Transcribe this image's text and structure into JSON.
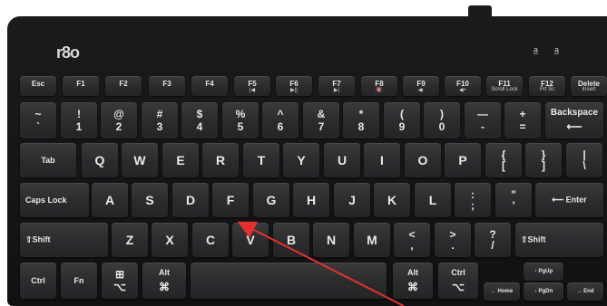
{
  "brand": {
    "logo_text": "r8o"
  },
  "indicators": [
    {
      "icon": "caps-lock-led-icon",
      "glyph": "a̲"
    },
    {
      "icon": "num-lock-led-icon",
      "glyph": "a̲"
    }
  ],
  "function_row": [
    {
      "main": "Esc",
      "sub": ""
    },
    {
      "main": "F1",
      "sub": ""
    },
    {
      "main": "F2",
      "sub": ""
    },
    {
      "main": "F3",
      "sub": ""
    },
    {
      "main": "F4",
      "sub": ""
    },
    {
      "main": "F5",
      "sub": "|◀"
    },
    {
      "main": "F6",
      "sub": "▶||"
    },
    {
      "main": "F7",
      "sub": "▶|"
    },
    {
      "main": "F8",
      "sub": "🔇"
    },
    {
      "main": "F9",
      "sub": "◀-"
    },
    {
      "main": "F10",
      "sub": "◀+"
    },
    {
      "main": "F11",
      "sub": "Scroll Lock"
    },
    {
      "main": "F12",
      "sub": "Prt Sc"
    },
    {
      "main": "Delete",
      "sub": "Insert"
    }
  ],
  "number_row": [
    {
      "top": "~",
      "bot": "`"
    },
    {
      "top": "!",
      "bot": "1"
    },
    {
      "top": "@",
      "bot": "2"
    },
    {
      "top": "#",
      "bot": "3"
    },
    {
      "top": "$",
      "bot": "4"
    },
    {
      "top": "%",
      "bot": "5"
    },
    {
      "top": "^",
      "bot": "6"
    },
    {
      "top": "&",
      "bot": "7"
    },
    {
      "top": "*",
      "bot": "8"
    },
    {
      "top": "(",
      "bot": "9"
    },
    {
      "top": ")",
      "bot": "0"
    },
    {
      "top": "—",
      "bot": "-"
    },
    {
      "top": "+",
      "bot": "="
    },
    {
      "top": "Backspace",
      "bot": "⟵"
    }
  ],
  "qwerty_row": {
    "tab": "Tab",
    "letters": [
      "Q",
      "W",
      "E",
      "R",
      "T",
      "Y",
      "U",
      "I",
      "O",
      "P"
    ],
    "brackets": [
      {
        "top": "{",
        "bot": "["
      },
      {
        "top": "}",
        "bot": "]"
      },
      {
        "top": "|",
        "bot": "\\"
      }
    ]
  },
  "home_row": {
    "caps": "Caps Lock",
    "letters": [
      "A",
      "S",
      "D",
      "F",
      "G",
      "H",
      "J",
      "K",
      "L"
    ],
    "punct": [
      {
        "top": ":",
        "bot": ";"
      },
      {
        "top": "\"",
        "bot": "'"
      }
    ],
    "enter": "⟵ Enter"
  },
  "shift_row": {
    "lshift": "⇧Shift",
    "letters": [
      "Z",
      "X",
      "C",
      "V",
      "B",
      "N",
      "M"
    ],
    "punct": [
      {
        "top": "<",
        "bot": ","
      },
      {
        "top": ">",
        "bot": "."
      },
      {
        "top": "?",
        "bot": "/"
      }
    ],
    "rshift": "⇧Shift"
  },
  "bottom_row": {
    "ctrl": "Ctrl",
    "fn": "Fn",
    "win_top": "⊞",
    "win_bot": "⌥",
    "alt_top": "Alt",
    "alt_bot": "⌘",
    "ralt_top": "Alt",
    "ralt_bot": "⌘",
    "rctrl_top": "Ctrl",
    "rctrl_bot": "⌥",
    "home": "← Home",
    "pgup": "↑ PgUp",
    "pgdn": "↓ PgDn",
    "end": "→ End"
  },
  "annotation": {
    "color": "#e53030"
  }
}
